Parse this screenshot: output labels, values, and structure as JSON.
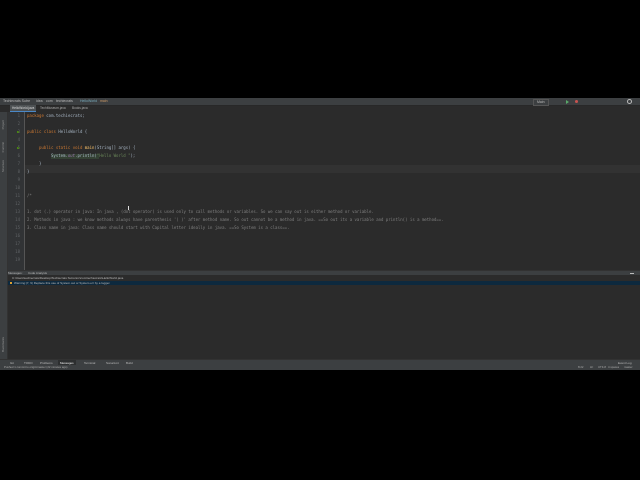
{
  "titlebar": {
    "project": "Techiecrats Sutre",
    "crumbs": [
      "idea",
      "com",
      "techiecrats",
      "HelloWorld",
      "main"
    ],
    "right_icons": [
      "run-config",
      "run-icon",
      "debug-icon",
      "search-icon"
    ]
  },
  "run_config": "Main",
  "tabs": [
    {
      "label": "HelloWorld.java",
      "active": true
    },
    {
      "label": "TechMuseum.java",
      "active": false
    },
    {
      "label": "Books.java",
      "active": false
    }
  ],
  "left_strip": [
    "Project",
    "Commit",
    "Structure",
    "Bookmarks"
  ],
  "gutter": {
    "lines": [
      "1",
      "2",
      "3",
      "4",
      "5",
      "6",
      "7",
      "8",
      "9",
      "10",
      "11",
      "12",
      "13",
      "14",
      "15",
      "16",
      "17",
      "18",
      "19"
    ]
  },
  "code": {
    "package_kw": "package",
    "package_name": " com.techiecrats;",
    "class_kw": "public class",
    "class_name": " HelloWorld {",
    "main_kw": "public static void",
    "main_name": " main",
    "main_args": "(String[] args) {",
    "sys": "System.",
    "out": "out",
    "println_pre": ".pr",
    "println_post": "intln(",
    "str": "\"Hello World \"",
    "end": ");",
    "close_inner": "}",
    "close_outer": "}",
    "comment_open": "/*",
    "c1": "1. dot (.) operator in java: In java , (dot operator) is used only to call methods or variables. So we can say out is either method or variable.",
    "c2": "2. Methods in java : we know methods always have parenthesis '( )' after method name. So out cannot be a method in java. ==So out its a variable and println() is a method==.",
    "c3": "3. Class name in java: Class name should start with Capital letter ideally in java. ==So System is a class==."
  },
  "panel_tabs": [
    "Messages:",
    "Code Analysis"
  ],
  "messages": {
    "path": "C:\\Users\\techiecrats\\Desktop\\Techiecrats Sutre\\src\\com\\techiecrats\\HelloWorld.java",
    "warning": "Warning:(7, 9)  Replace this use of System.out or System.err by a logger."
  },
  "bottom_tools": [
    {
      "label": "Git",
      "active": false
    },
    {
      "label": "TODO",
      "active": false
    },
    {
      "label": "Problems",
      "active": false
    },
    {
      "label": "Messages",
      "active": true
    },
    {
      "label": "Terminal",
      "active": false
    },
    {
      "label": "SonarLint",
      "active": false
    },
    {
      "label": "Build",
      "active": false
    }
  ],
  "status": {
    "left": "Pushed 1 commit to origin/master (22 minutes ago)",
    "event_log": "Event Log",
    "pos": "8:22",
    "le": "LF",
    "enc": "UTF-8",
    "indent": "4 spaces",
    "branch": "master"
  }
}
